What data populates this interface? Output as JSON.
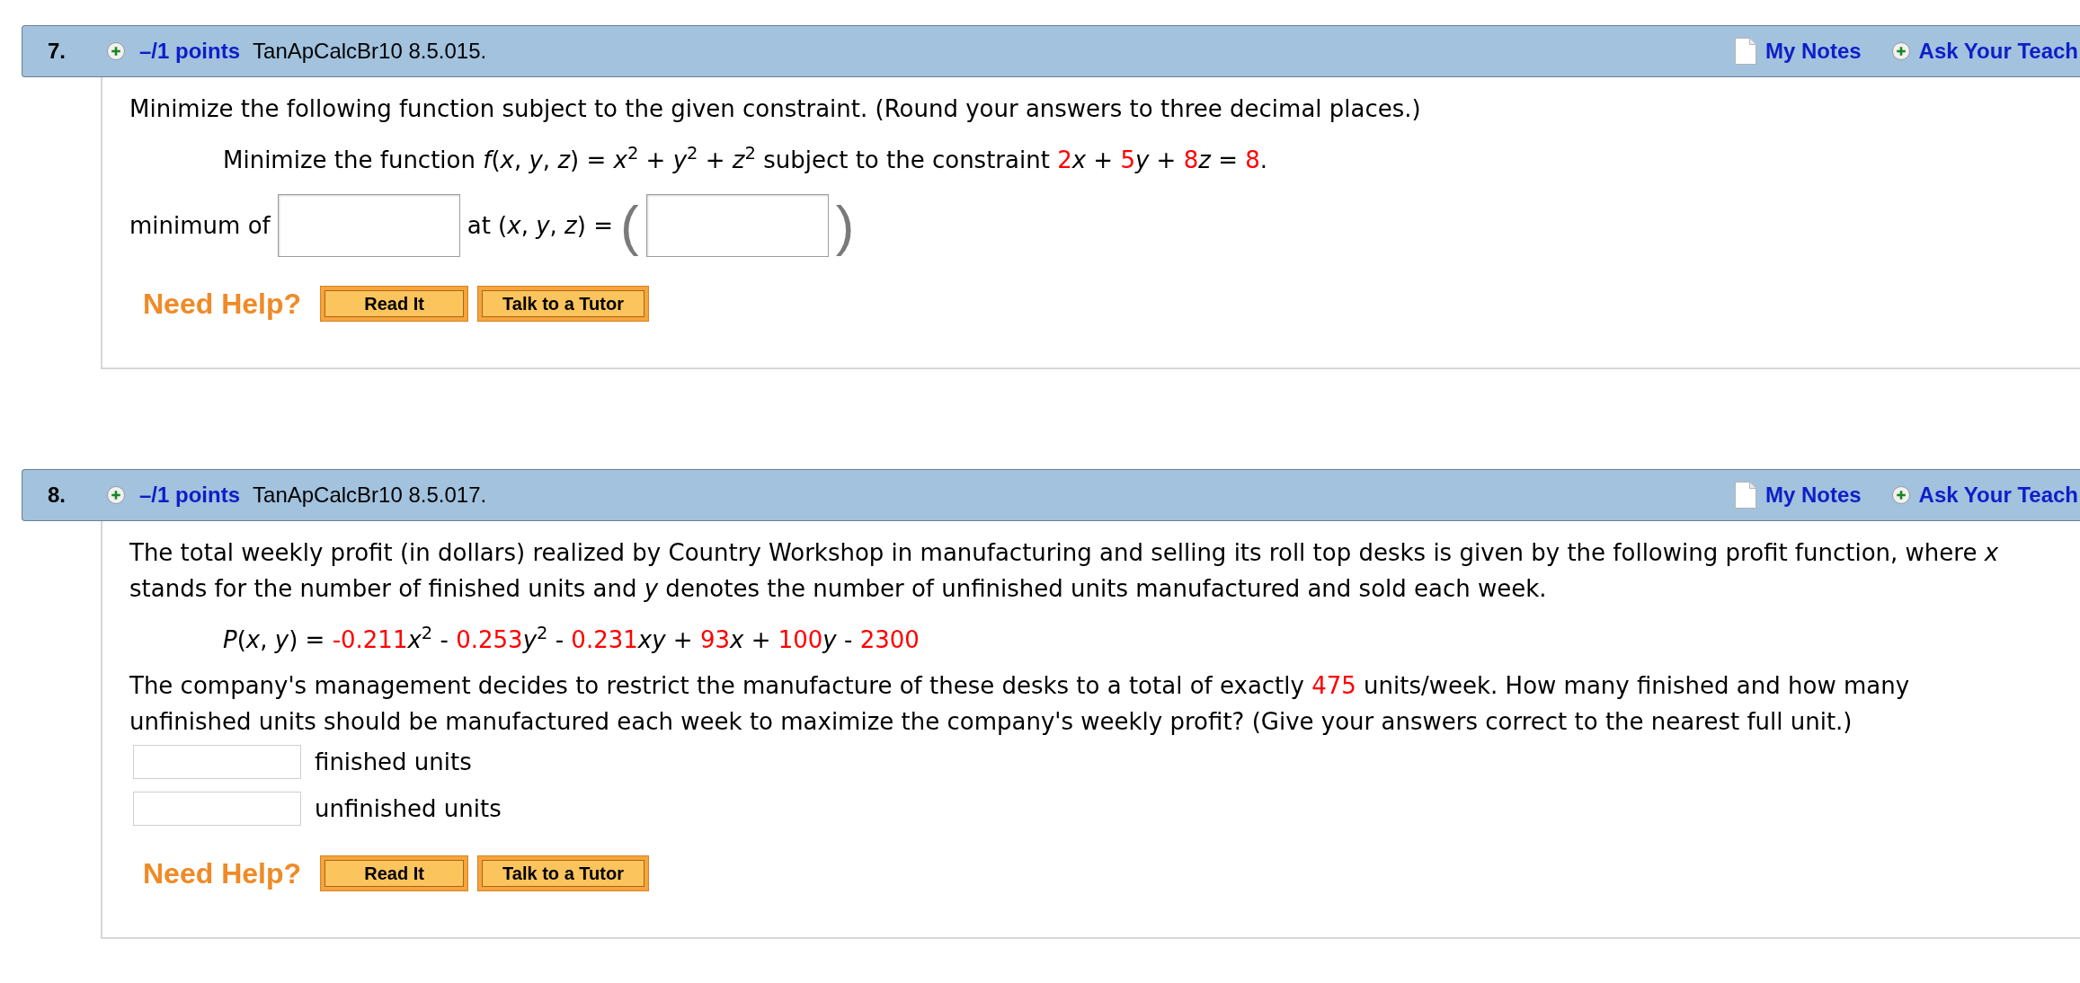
{
  "questions": [
    {
      "number": "7.",
      "points": "–/1 points",
      "code": "TanApCalcBr10 8.5.015.",
      "links": [
        {
          "kind": "notes",
          "label": "My Notes"
        },
        {
          "kind": "ask",
          "label": "Ask Your Teach"
        }
      ],
      "body": [
        {
          "kind": "paragraph",
          "segments": [
            {
              "text": "Minimize the following function subject to the given constraint. (Round your answers to three decimal places.)",
              "given": false
            }
          ]
        },
        {
          "kind": "formula",
          "segments": [
            {
              "text": "Minimize the function *f*(*x*, *y*, *z*) = *x*$^{2}$ + *y*$^{2}$ + *z*$^{2}$ subject to the constraint ",
              "given": false
            },
            {
              "text": "2",
              "given": true
            },
            {
              "text": "*x* + ",
              "given": false
            },
            {
              "text": "5",
              "given": true
            },
            {
              "text": "*y* + ",
              "given": false
            },
            {
              "text": "8",
              "given": true
            },
            {
              "text": "*z* = ",
              "given": false
            },
            {
              "text": "8",
              "given": true
            },
            {
              "text": ".",
              "given": false
            }
          ]
        },
        {
          "kind": "answer_row",
          "items": [
            {
              "kind": "label",
              "text": "minimum of"
            },
            {
              "kind": "input"
            },
            {
              "kind": "label",
              "text": "at (*x*, *y*, *z*) ="
            },
            {
              "kind": "paren",
              "text": "("
            },
            {
              "kind": "input"
            },
            {
              "kind": "paren",
              "text": ")"
            }
          ]
        },
        {
          "kind": "help",
          "label": "Need Help?",
          "buttons": [
            "Read It",
            "Talk to a Tutor"
          ]
        }
      ]
    },
    {
      "number": "8.",
      "points": "–/1 points",
      "code": "TanApCalcBr10 8.5.017.",
      "links": [
        {
          "kind": "notes",
          "label": "My Notes"
        },
        {
          "kind": "ask",
          "label": "Ask Your Teach"
        }
      ],
      "body": [
        {
          "kind": "paragraph",
          "segments": [
            {
              "text": "The total weekly profit (in dollars) realized by Country Workshop in manufacturing and selling its roll top desks is given by the following profit function, where *x* stands for the number of finished units and *y* denotes the number of unfinished units manufactured and sold each week.",
              "given": false
            }
          ]
        },
        {
          "kind": "formula",
          "segments": [
            {
              "text": "*P*(*x*, *y*) = ",
              "given": false
            },
            {
              "text": "-0.211",
              "given": true
            },
            {
              "text": "*x*$^{2}$ - ",
              "given": false
            },
            {
              "text": "0.253",
              "given": true
            },
            {
              "text": "*y*$^{2}$ - ",
              "given": false
            },
            {
              "text": "0.231",
              "given": true
            },
            {
              "text": "*xy* + ",
              "given": false
            },
            {
              "text": "93",
              "given": true
            },
            {
              "text": "*x* + ",
              "given": false
            },
            {
              "text": "100",
              "given": true
            },
            {
              "text": "*y* - ",
              "given": false
            },
            {
              "text": "2300",
              "given": true
            }
          ]
        },
        {
          "kind": "paragraph",
          "segments": [
            {
              "text": "The company's management decides to restrict the manufacture of these desks to a total of exactly ",
              "given": false
            },
            {
              "text": "475",
              "given": true
            },
            {
              "text": " units/week. How many finished and how many unfinished units should be manufactured each week to maximize the company's weekly profit? (Give your answers correct to the nearest full unit.)",
              "given": false
            }
          ]
        },
        {
          "kind": "answer_list",
          "items": [
            {
              "label": "finished units"
            },
            {
              "label": "unfinished units"
            }
          ]
        },
        {
          "kind": "help",
          "label": "Need Help?",
          "buttons": [
            "Read It",
            "Talk to a Tutor"
          ]
        }
      ]
    }
  ]
}
